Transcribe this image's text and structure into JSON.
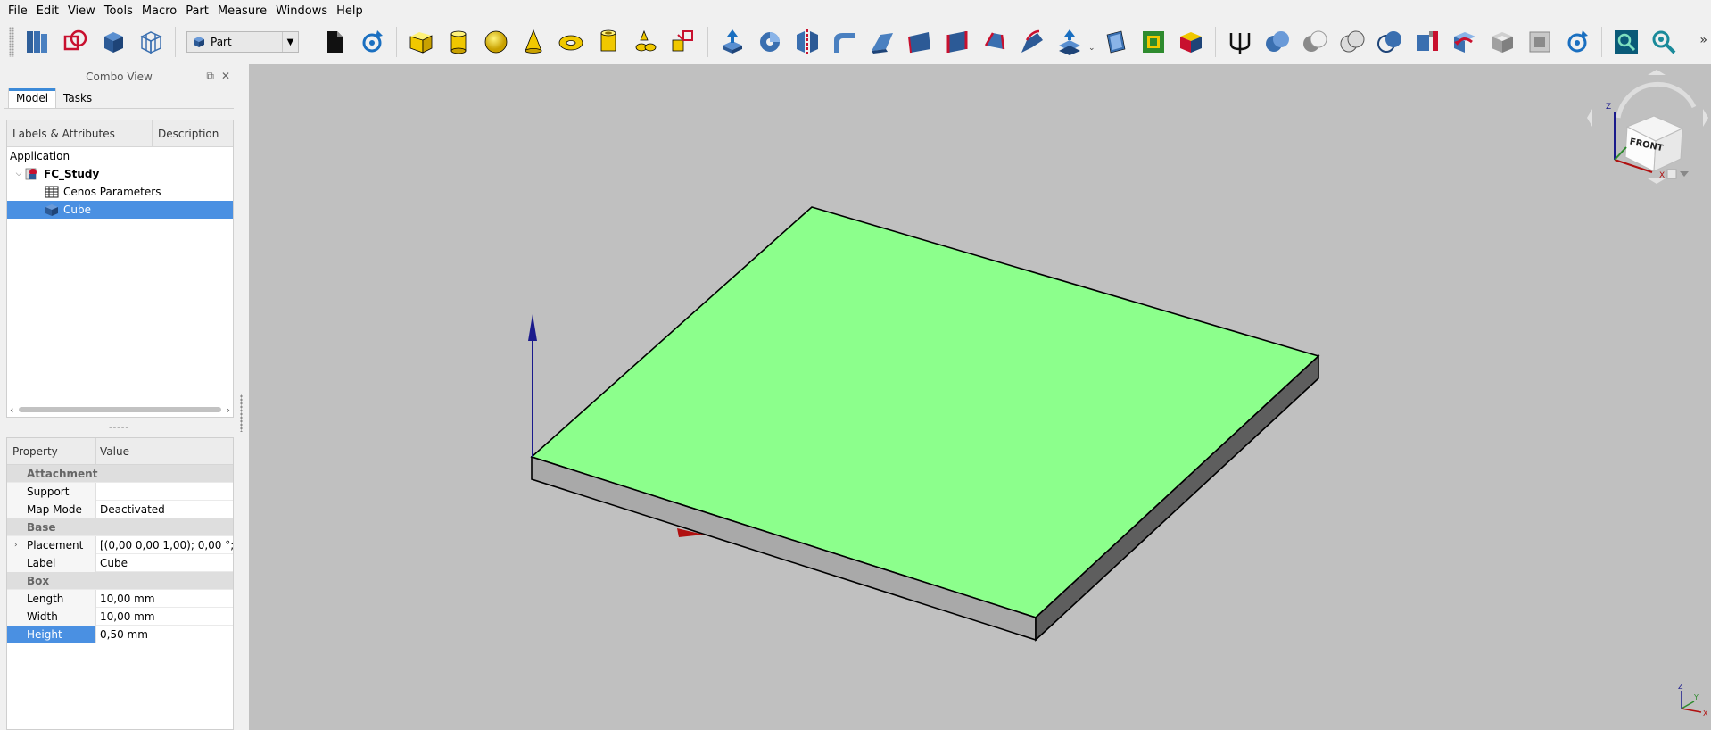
{
  "menu": [
    "File",
    "Edit",
    "View",
    "Tools",
    "Macro",
    "Part",
    "Measure",
    "Windows",
    "Help"
  ],
  "workbench": {
    "selected": "Part"
  },
  "combo": {
    "title": "Combo View",
    "tabs": [
      "Model",
      "Tasks"
    ],
    "tree": {
      "headers": [
        "Labels & Attributes",
        "Description"
      ],
      "root_label": "Application",
      "document": "FC_Study",
      "items": [
        "Cenos Parameters",
        "Cube"
      ],
      "selected_item": "Cube"
    },
    "properties": {
      "headers": [
        "Property",
        "Value"
      ],
      "groups": [
        {
          "name": "Attachment",
          "rows": [
            {
              "property": "Support",
              "value": ""
            },
            {
              "property": "Map Mode",
              "value": "Deactivated"
            }
          ]
        },
        {
          "name": "Base",
          "rows": [
            {
              "property": "Placement",
              "value": "[(0,00 0,00 1,00); 0,00 °; (0,...",
              "expandable": true
            },
            {
              "property": "Label",
              "value": "Cube"
            }
          ]
        },
        {
          "name": "Box",
          "rows": [
            {
              "property": "Length",
              "value": "10,00 mm"
            },
            {
              "property": "Width",
              "value": "10,00 mm"
            },
            {
              "property": "Height",
              "value": "0,50 mm",
              "selected": true
            }
          ]
        }
      ]
    }
  },
  "view": {
    "background": "#c0c0c0",
    "top_face_color": "#8cff8c",
    "navcube": {
      "front_label": "FRONT",
      "axes": [
        "Z",
        "X"
      ]
    },
    "mini_axes": [
      "Z",
      "Y",
      "X"
    ]
  },
  "colors": {
    "selection": "#4a90e2",
    "axis_x": "#b01010",
    "axis_z": "#1a1a8c"
  }
}
